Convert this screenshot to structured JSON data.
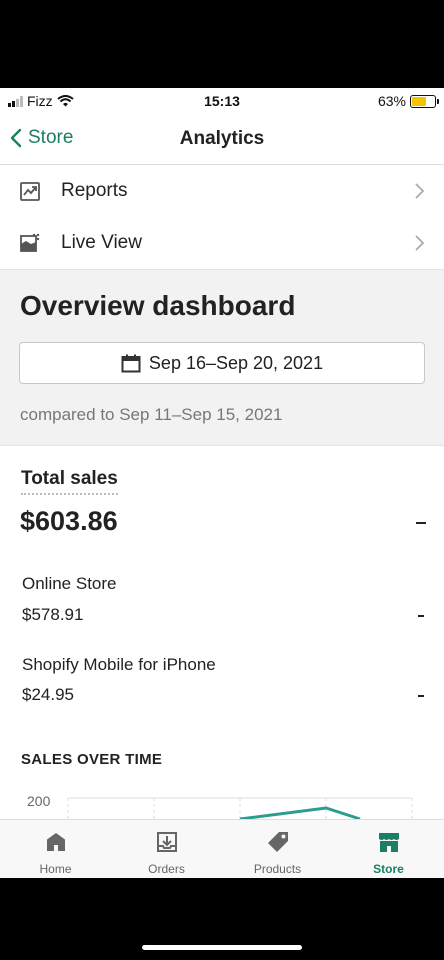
{
  "status": {
    "carrier": "Fizz",
    "time": "15:13",
    "battery": "63%",
    "battery_level": 0.63
  },
  "nav": {
    "back_label": "Store",
    "title": "Analytics"
  },
  "menu": [
    {
      "label": "Reports",
      "icon": "reports-icon"
    },
    {
      "label": "Live View",
      "icon": "live-view-icon"
    }
  ],
  "overview": {
    "title": "Overview dashboard",
    "date_range": "Sep 16–Sep 20, 2021",
    "compared": "compared to Sep 11–Sep 15, 2021"
  },
  "total_sales": {
    "label": "Total sales",
    "value": "$603.86",
    "breakdown": [
      {
        "label": "Online Store",
        "value": "$578.91"
      },
      {
        "label": "Shopify Mobile for iPhone",
        "value": "$24.95"
      }
    ]
  },
  "sales_over_time": {
    "title": "SALES OVER TIME",
    "y_tick": "200"
  },
  "tabs": [
    {
      "label": "Home",
      "icon": "home-icon"
    },
    {
      "label": "Orders",
      "icon": "orders-icon"
    },
    {
      "label": "Products",
      "icon": "tag-icon"
    },
    {
      "label": "Store",
      "icon": "storefront-icon"
    }
  ],
  "colors": {
    "accent": "#1a7f64",
    "battery": "#f5c400"
  }
}
